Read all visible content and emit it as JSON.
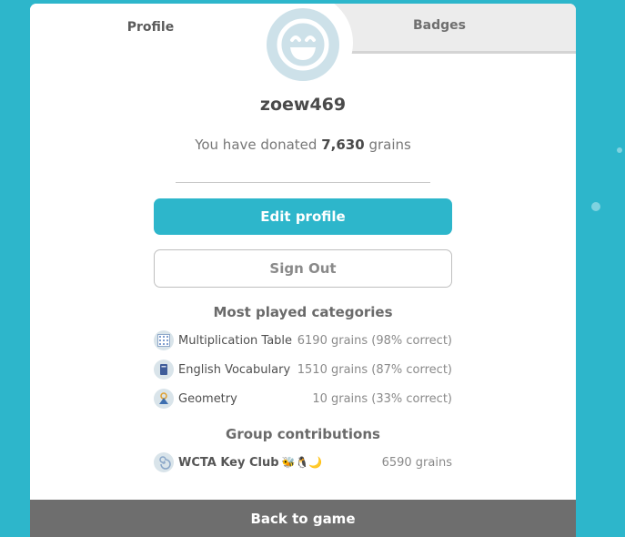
{
  "tabs": {
    "profile": "Profile",
    "badges": "Badges"
  },
  "user": {
    "username": "zoew469"
  },
  "donation": {
    "prefix": "You have donated",
    "amount": "7,630",
    "suffix": "grains"
  },
  "buttons": {
    "edit_profile": "Edit profile",
    "sign_out": "Sign Out",
    "back_to_game": "Back to game"
  },
  "categories": {
    "title": "Most played categories",
    "items": [
      {
        "name": "Multiplication Table",
        "value": "6190 grains (98% correct)",
        "icon": "multiplication-grid-icon"
      },
      {
        "name": "English Vocabulary",
        "value": "1510 grains (87% correct)",
        "icon": "book-icon"
      },
      {
        "name": "Geometry",
        "value": "10 grains (33% correct)",
        "icon": "geometry-icon"
      }
    ]
  },
  "groups": {
    "title": "Group contributions",
    "items": [
      {
        "name": "WCTA Key Club",
        "emojis": "🐝🐧🌙",
        "value": "6590 grains",
        "icon": "group-swirl-icon"
      }
    ]
  },
  "colors": {
    "accent": "#2db6cb",
    "back_bar": "#6e6e6e",
    "background": "#2db6cb"
  }
}
